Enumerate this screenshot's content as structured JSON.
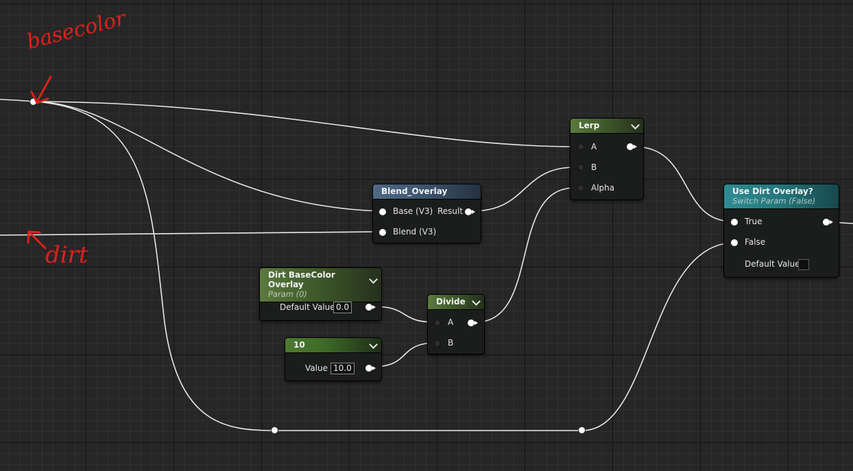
{
  "annotations": {
    "basecolor_label": "basecolor",
    "dirt_label": "dirt",
    "color": "#e0201b"
  },
  "nodes": {
    "lerp": {
      "title": "Lerp",
      "pins": {
        "a": "A",
        "b": "B",
        "alpha": "Alpha"
      }
    },
    "blend_overlay": {
      "title": "Blend_Overlay",
      "pins": {
        "base": "Base (V3)",
        "blend": "Blend (V3)",
        "result": "Result"
      }
    },
    "use_dirt_overlay": {
      "title": "Use Dirt Overlay?",
      "subtitle": "Switch Param (False)",
      "pins": {
        "true": "True",
        "false": "False"
      },
      "default_label": "Default Value",
      "default_value": false
    },
    "dirt_basecolor_overlay": {
      "title": "Dirt BaseColor Overlay",
      "subtitle": "Param (0)",
      "default_label": "Default Value",
      "default_value": "0.0"
    },
    "constant_10": {
      "title": "10",
      "value_label": "Value",
      "value": "10.0"
    },
    "divide": {
      "title": "Divide",
      "pins": {
        "a": "A",
        "b": "B"
      }
    }
  },
  "icons": [
    "chevron-down-icon",
    "reroute-node-icon",
    "arrow-annotation-icon"
  ],
  "colors": {
    "canvas_bg": "#262626",
    "param_header": "#5a7a3e",
    "function_header": "#4f6a86",
    "switch_header": "#2e8c92",
    "wire": "#e6e6e6"
  }
}
